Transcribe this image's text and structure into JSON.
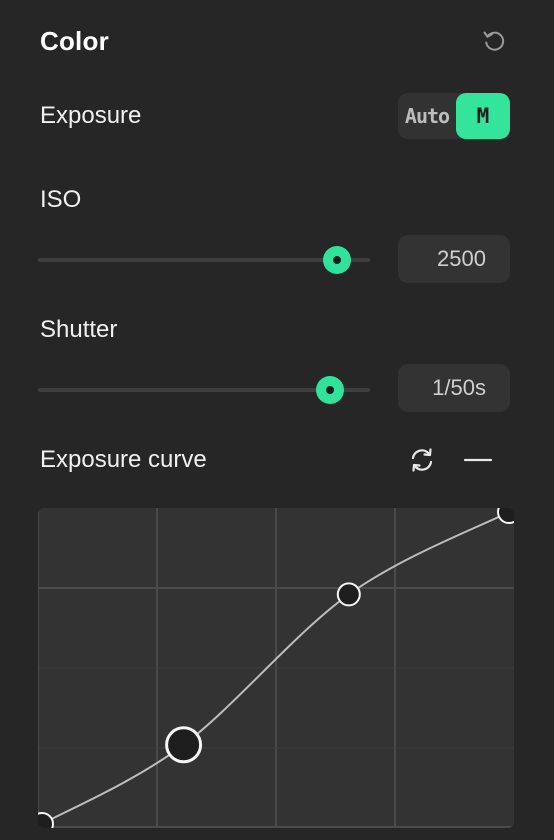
{
  "panel": {
    "title": "Color",
    "reset_icon": "reset-icon"
  },
  "exposure": {
    "label": "Exposure",
    "mode_options": [
      "Auto",
      "M"
    ],
    "selected_mode": "M",
    "accent_color": "#33e59a"
  },
  "iso": {
    "label": "ISO",
    "value": "2500",
    "slider_level": 0.9
  },
  "shutter": {
    "label": "Shutter",
    "value": "1/50s",
    "slider_level": 0.88
  },
  "curve": {
    "label": "Exposure curve",
    "refresh_icon": "refresh-icon",
    "collapse_icon": "minus-icon",
    "control_points": [
      {
        "x": 0.0,
        "y": 0.0
      },
      {
        "x": 0.3,
        "y": 0.26
      },
      {
        "x": 0.65,
        "y": 0.73
      },
      {
        "x": 1.0,
        "y": 1.0
      }
    ],
    "selected_point": 1
  }
}
